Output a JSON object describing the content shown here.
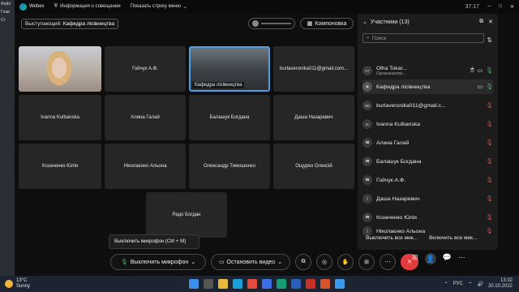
{
  "window": {
    "app_name": "Webex",
    "info_label": "Информация о совещании",
    "show_menu_label": "Показать строку меню",
    "clock": "37:17"
  },
  "left_strip": {
    "items": [
      "Файл",
      "Глав",
      "Ст"
    ]
  },
  "speaker": {
    "prefix": "Выступающий:",
    "name": "Кафедра лісівництва"
  },
  "layout_button": "Компоновка",
  "tiles": [
    {
      "label": ""
    },
    {
      "label": "Гойчук А.Ф."
    },
    {
      "label": "Кафедра лісівництва"
    },
    {
      "label": "burlaveronika011@gmail.com..."
    },
    {
      "label": "Ivanna Kulbanska"
    },
    {
      "label": "Алина Галай"
    },
    {
      "label": "Балашук Богдана"
    },
    {
      "label": "Даша Назаревич"
    },
    {
      "label": "Козаченко Юлія"
    },
    {
      "label": "Ніколаєнко Альона"
    },
    {
      "label": "Олександр Тимошенко"
    },
    {
      "label": "Ощурко Олексій"
    },
    {
      "label": "Радо Богдан"
    }
  ],
  "tooltip": "Выключить микрофон (Ctrl + M)",
  "controls": {
    "mute": "Выключить микрофон",
    "video": "Остановить видео"
  },
  "panel": {
    "title": "Участники (13)",
    "search_placeholder": "Поиск",
    "participants": [
      {
        "initials": "OT",
        "name": "Olha Tokar...",
        "role": "Организатор..."
      },
      {
        "initials": "",
        "name": "Кафедра лісівництва"
      },
      {
        "initials": "BB",
        "name": "burlaveronika011@gmail.c..."
      },
      {
        "initials": "IK",
        "name": "Ivanna Kulbanska"
      },
      {
        "initials": "",
        "name": "Алина Галай"
      },
      {
        "initials": "",
        "name": "Балашук Богдана"
      },
      {
        "initials": "",
        "name": "Гойчук А.Ф."
      },
      {
        "initials": "",
        "name": "Даша Назаревич"
      },
      {
        "initials": "",
        "name": "Козаченко Юлія"
      },
      {
        "initials": "",
        "name": "Ніколаєнко Альона"
      }
    ],
    "mute_all": "Выключить все мик...",
    "unmute_all": "Включить все мик..."
  },
  "taskbar": {
    "temp": "13°C",
    "weather": "Sunny",
    "lang": "РУС",
    "time": "13:32",
    "date": "20.10.2022"
  }
}
